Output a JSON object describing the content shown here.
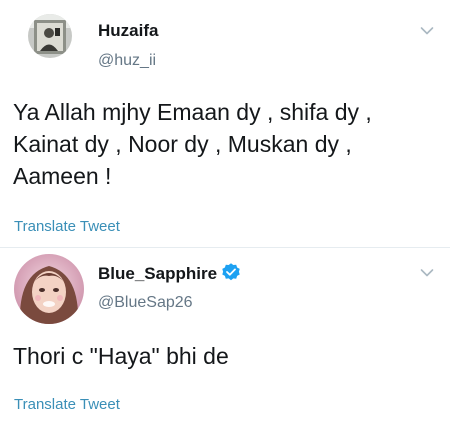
{
  "tweets": [
    {
      "display_name": "Huzaifa",
      "handle": "@huz_ii",
      "verified": false,
      "text": "Ya Allah mjhy Emaan dy , shifa dy , Kainat dy , Noor dy , Muskan dy , Aameen !",
      "translate_label": "Translate Tweet",
      "avatar_icon": "profile-photo-mirror-selfie"
    },
    {
      "display_name": "Blue_Sapphire",
      "handle": "@BlueSap26",
      "verified": true,
      "text": "Thori c \"Haya\" bhi de",
      "translate_label": "Translate Tweet",
      "avatar_icon": "profile-photo-filtered-face"
    }
  ],
  "colors": {
    "text": "#14171a",
    "secondary": "#657786",
    "link": "#3a8fb7",
    "verified": "#1da1f2",
    "chevron": "#aab8c2",
    "divider": "#e6ecf0"
  }
}
